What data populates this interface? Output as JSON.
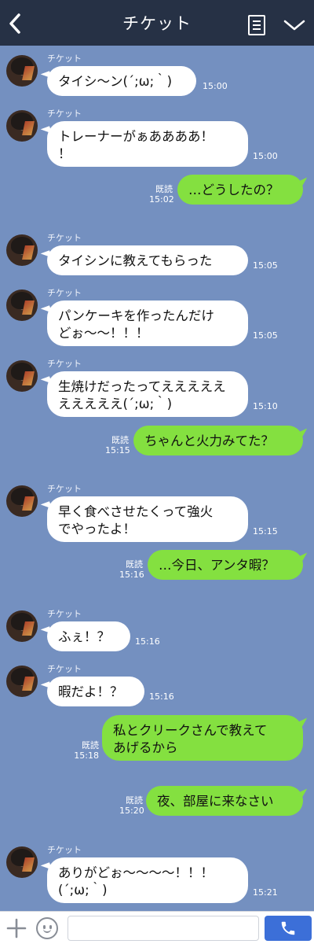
{
  "header": {
    "title": "チケット",
    "back_icon": "chevron-left-icon",
    "menu_icon": "list-icon",
    "collapse_icon": "chevron-down-icon"
  },
  "sender_name": "チケット",
  "read_label": "既読",
  "messages": [
    {
      "dir": "in",
      "lines": [
        "タイシ〜ン(´;ω;｀)"
      ],
      "time": "15:00"
    },
    {
      "dir": "in",
      "lines": [
        "トレーナーがぁああああ！",
        "！"
      ],
      "time": "15:00"
    },
    {
      "dir": "out",
      "lines": [
        "…どうしたの？"
      ],
      "time": "15:02"
    },
    {
      "dir": "in",
      "lines": [
        "タイシンに教えてもらった"
      ],
      "time": "15:05"
    },
    {
      "dir": "in",
      "lines": [
        "パンケーキを作ったんだけ",
        "どぉ〜〜！！！"
      ],
      "time": "15:05"
    },
    {
      "dir": "in",
      "lines": [
        "生焼けだったってえええええ",
        "えええええ(´;ω;｀)"
      ],
      "time": "15:10"
    },
    {
      "dir": "out",
      "lines": [
        "ちゃんと火力みてた？"
      ],
      "time": "15:15"
    },
    {
      "dir": "in",
      "lines": [
        "早く食べさせたくって強火",
        "でやったよ！"
      ],
      "time": "15:15"
    },
    {
      "dir": "out",
      "lines": [
        "…今日、アンタ暇？"
      ],
      "time": "15:16"
    },
    {
      "dir": "in",
      "lines": [
        "ふぇ！？"
      ],
      "time": "15:16"
    },
    {
      "dir": "in",
      "lines": [
        "暇だよ！？"
      ],
      "time": "15:16"
    },
    {
      "dir": "out",
      "lines": [
        "私とクリークさんで教えて",
        "あげるから"
      ],
      "time": "15:18"
    },
    {
      "dir": "out",
      "lines": [
        "夜、部屋に来なさい"
      ],
      "time": "15:20"
    },
    {
      "dir": "in",
      "lines": [
        "ありがどぉ〜〜〜〜！！！",
        "(´;ω;｀)"
      ],
      "time": "15:21"
    }
  ],
  "input": {
    "value": "",
    "placeholder": ""
  },
  "icons": {
    "plus": "plus-icon",
    "emoji": "emoji-icon",
    "send": "phone-icon"
  },
  "colors": {
    "background": "#7490c0",
    "header": "#263145",
    "incoming_bubble": "#ffffff",
    "outgoing_bubble": "#84e040",
    "send_button": "#3c6fd8"
  }
}
